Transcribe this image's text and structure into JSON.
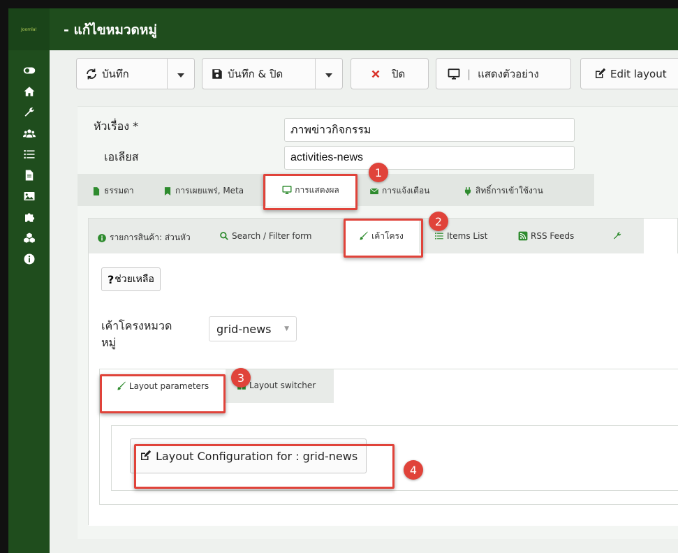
{
  "app": {
    "logo_text": "Joomla!"
  },
  "header": {
    "title": "- แก้ไขหมวดหมู่"
  },
  "sidebar": {
    "items": [
      {
        "icon": "toggle-icon"
      },
      {
        "icon": "home-icon"
      },
      {
        "icon": "wrench-icon"
      },
      {
        "icon": "users-icon"
      },
      {
        "icon": "list-icon"
      },
      {
        "icon": "file-icon"
      },
      {
        "icon": "image-icon"
      },
      {
        "icon": "puzzle-icon"
      },
      {
        "icon": "cubes-icon"
      },
      {
        "icon": "info-icon"
      }
    ]
  },
  "toolbar": {
    "save_label": "บันทึก",
    "save_close_label": "บันทึก & ปิด",
    "close_label": "ปิด",
    "preview_label": "แสดงตัวอย่าง",
    "edit_layout_label": "Edit layout"
  },
  "form": {
    "title_label": "หัวเรื่อง *",
    "title_value": "ภาพข่าวกิจกรรม",
    "alias_label": "เอเลียส",
    "alias_value": "activities-news"
  },
  "tabs1": [
    {
      "label": "ธรรมดา"
    },
    {
      "label": "การเผยแพร่, Meta"
    },
    {
      "label": "การแสดงผล"
    },
    {
      "label": "การแจ้งเตือน"
    },
    {
      "label": "สิทธิ์การเข้าใช้งาน"
    }
  ],
  "tabs2": [
    {
      "label": "รายการสินค้า: ส่วนหัว"
    },
    {
      "label": "Search / Filter form"
    },
    {
      "label": "เค้าโครง"
    },
    {
      "label": "Items List"
    },
    {
      "label": "RSS Feeds"
    }
  ],
  "help": {
    "label": "ช่วยเหลือ",
    "mark": "?"
  },
  "layout": {
    "label": "เค้าโครงหมวดหมู่",
    "value": "grid-news",
    "tabs": [
      {
        "label": "Layout parameters"
      },
      {
        "label": "Layout switcher"
      }
    ],
    "config_label": "Layout Configuration for : grid-news"
  },
  "annotations": [
    "1",
    "2",
    "3",
    "4"
  ],
  "colors": {
    "dark_green": "#1f4d1d",
    "highlight_red": "#e0433a",
    "close_red": "#d9342b"
  }
}
